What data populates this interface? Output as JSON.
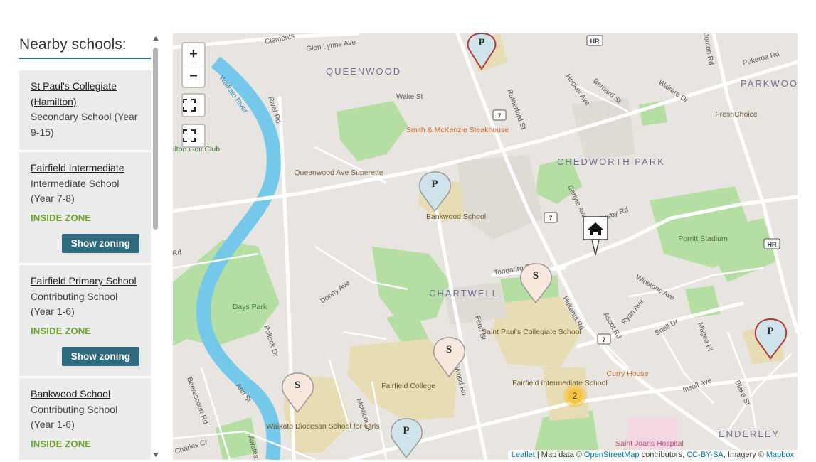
{
  "sidebar": {
    "title": "Nearby schools:",
    "schools": [
      {
        "name": "St Paul's Collegiate (Hamilton)",
        "type": "Secondary School (Year 9-15)"
      },
      {
        "name": "Fairfield Intermediate",
        "type": "Intermediate School (Year 7-8)",
        "zone": "INSIDE ZONE",
        "button": "Show zoning"
      },
      {
        "name": "Fairfield Primary School",
        "type": "Contributing School (Year 1-6)",
        "zone": "INSIDE ZONE",
        "button": "Show zoning"
      },
      {
        "name": "Bankwood School",
        "type": "Contributing School (Year 1-6)",
        "zone": "INSIDE ZONE"
      }
    ]
  },
  "map": {
    "controls": {
      "zoom_in": "+",
      "zoom_out": "−"
    },
    "areas": [
      "QUEENWOOD",
      "CHEDWORTH PARK",
      "CHARTWELL",
      "PARKWOOD",
      "ENDERLEY"
    ],
    "roads": [
      "Clements",
      "Glen Lynne Ave",
      "Wake St",
      "Rutherford St",
      "Hooker Ave",
      "Bernard St",
      "Wairere Dr",
      "Jonton Rd",
      "Pukeroa Rd",
      "River Rd",
      "Waikato River",
      "Carlyle Ave",
      "Ensby Rd",
      "Tongariro St",
      "Winstone Ave",
      "Hukanui Rd",
      "Ascot Rd",
      "Ryan Ave",
      "Snell Dr",
      "Magee Pl",
      "Fend St",
      "Donny Ave",
      "Pollock Dr",
      "Insoll Ave",
      "Blake St",
      "Beerescourt Rd",
      "Ann St",
      "McNicol St",
      "Charles Cr",
      "Awatea",
      "Wood Rd",
      "Rd"
    ],
    "shields": [
      "7",
      "7",
      "7",
      "HR",
      "HR"
    ],
    "places": [
      "Smith & McKenzie Steakhouse",
      "Queenwood Ave Superette",
      "Bankwood School",
      "Porritt Stadium",
      "Days Park",
      "Saint Paul's Collegiate School",
      "Fairfield College",
      "Fairfield Intermediate School",
      "Curry House",
      "Waikato Diocesan School for Girls",
      "Saint Joans Hospital",
      "FreshChoice",
      "Hamilton Golf Club"
    ],
    "markers": [
      "P",
      "P",
      "P",
      "P",
      "S",
      "S",
      "S"
    ],
    "cluster": "2",
    "attribution": {
      "leaflet": "Leaflet",
      "map_data": "| Map data ©",
      "osm": "OpenStreetMap",
      "contributors": "contributors,",
      "license": "CC-BY-SA",
      "imagery": ", Imagery ©",
      "mapbox": "Mapbox"
    }
  },
  "colors": {
    "accent": "#2e6b7f",
    "inside_zone": "#6aa22b",
    "river": "#74c9ea",
    "park": "#b4dea2",
    "school_area": "#e8dcb5",
    "marker_primary": "#cfe3ea",
    "marker_secondary": "#f7e7dc",
    "cluster": "#f5c542"
  }
}
